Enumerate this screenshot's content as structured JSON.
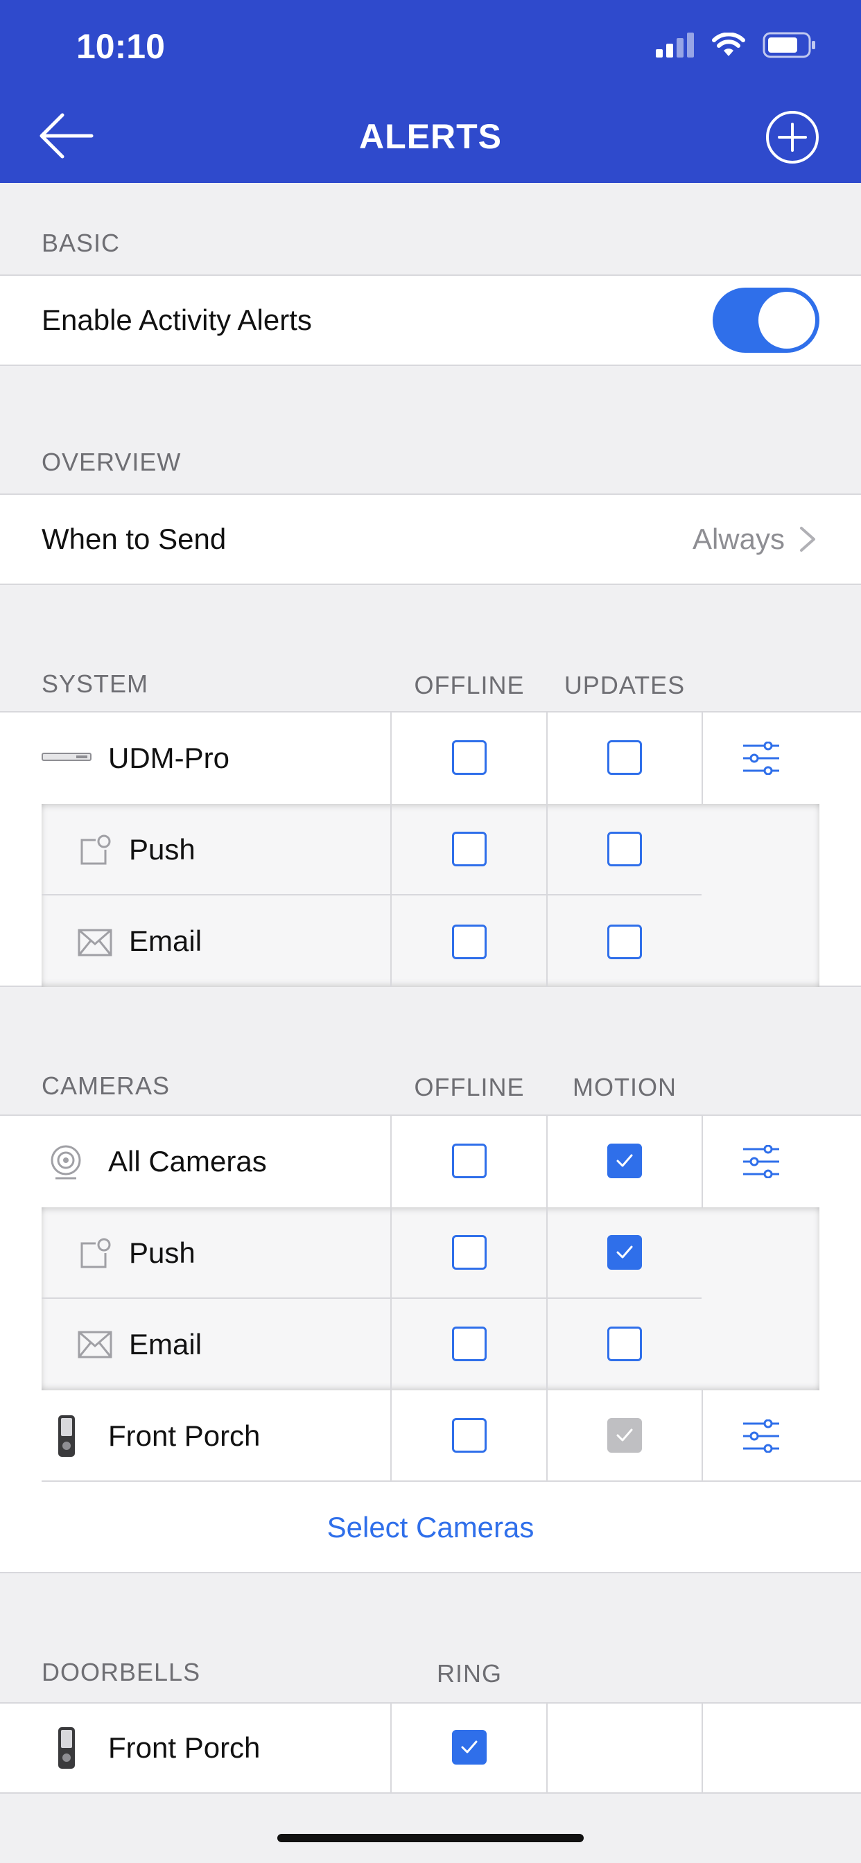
{
  "status_bar": {
    "time": "10:10"
  },
  "header": {
    "title": "ALERTS",
    "back_icon": "arrow-left-icon",
    "add_icon": "plus-circle-icon"
  },
  "basic": {
    "label": "BASIC",
    "enable_label": "Enable Activity Alerts",
    "enabled": true
  },
  "overview": {
    "label": "OVERVIEW",
    "when_label": "When to Send",
    "when_value": "Always"
  },
  "system": {
    "label": "SYSTEM",
    "col1": "OFFLINE",
    "col2": "UPDATES",
    "device": {
      "name": "UDM-Pro",
      "offline": false,
      "updates": false
    },
    "push": {
      "name": "Push",
      "offline": false,
      "updates": false
    },
    "email": {
      "name": "Email",
      "offline": false,
      "updates": false
    }
  },
  "cameras": {
    "label": "CAMERAS",
    "col1": "OFFLINE",
    "col2": "MOTION",
    "all": {
      "name": "All Cameras",
      "offline": false,
      "motion": true
    },
    "push": {
      "name": "Push",
      "offline": false,
      "motion": true
    },
    "email": {
      "name": "Email",
      "offline": false,
      "motion": false
    },
    "front_porch": {
      "name": "Front Porch",
      "offline": false,
      "motion": "inherited"
    },
    "select_label": "Select Cameras"
  },
  "doorbells": {
    "label": "DOORBELLS",
    "col1": "RING",
    "front_porch": {
      "name": "Front Porch",
      "ring": true
    }
  },
  "colors": {
    "header": "#2f4acc",
    "accent": "#2f6fea",
    "background": "#f0f0f2"
  }
}
